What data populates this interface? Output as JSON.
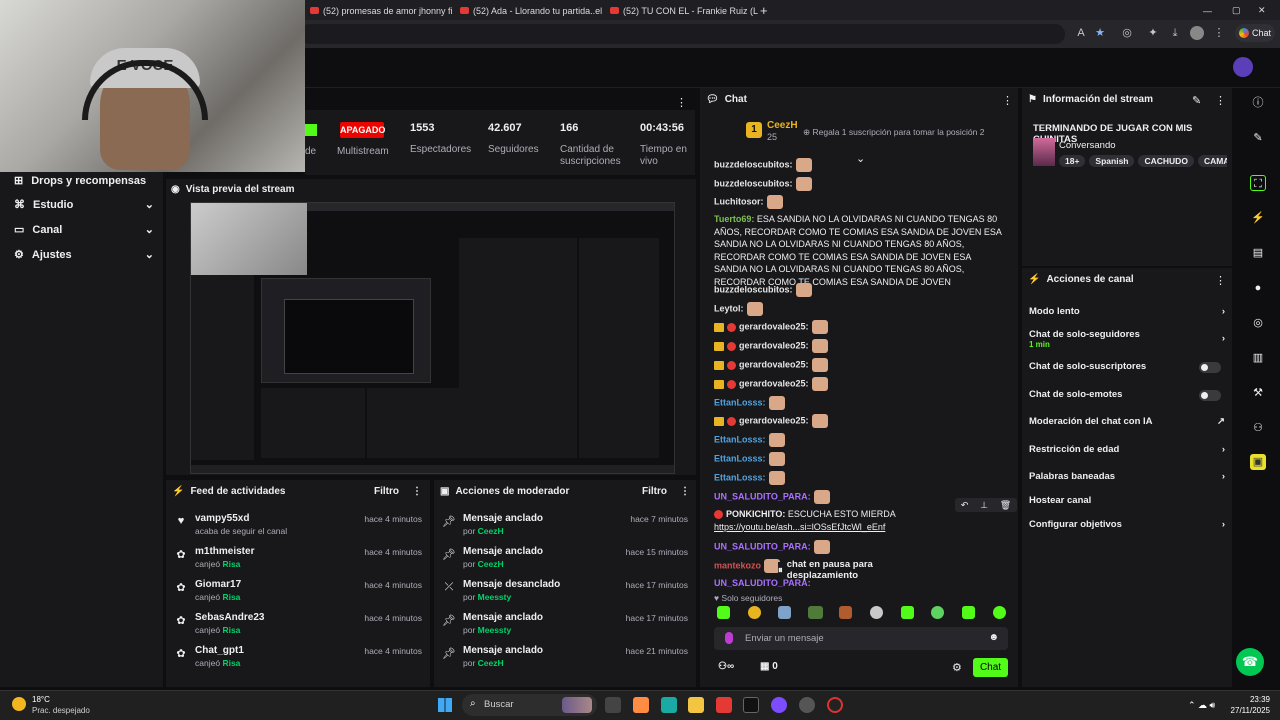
{
  "browser": {
    "tabs": [
      {
        "label": "(52) promesas de amor jhonny fi"
      },
      {
        "label": "(52) Ada - Llorando tu partida..el"
      },
      {
        "label": "(52) TU CON EL - Frankie Ruiz (Le"
      }
    ],
    "chat_button": "Chat"
  },
  "webcam": {
    "cap_text": "E VOCE"
  },
  "nav": {
    "items": [
      {
        "label": "Drops y recompensas"
      },
      {
        "label": "Estudio"
      },
      {
        "label": "Canal"
      },
      {
        "label": "Ajustes"
      }
    ]
  },
  "stats": {
    "status_badge": "APAGADO",
    "status_label": "Multistream",
    "left_partial": "de",
    "items": [
      {
        "value": "1553",
        "label": "Espectadores"
      },
      {
        "value": "42.607",
        "label": "Seguidores"
      },
      {
        "value": "166",
        "label": "Cantidad de suscripciones"
      },
      {
        "value": "00:43:56",
        "label": "Tiempo en vivo"
      }
    ]
  },
  "preview": {
    "title": "Vista previa del stream"
  },
  "feed": {
    "title": "Feed de actividades",
    "filter": "Filtro",
    "rows": [
      {
        "user": "vampy55xd",
        "detail": "acaba de seguir el canal",
        "highlight": "",
        "time": "hace 4 minutos"
      },
      {
        "user": "m1thmeister",
        "detail": "canjeó",
        "highlight": "Risa",
        "time": "hace 4 minutos"
      },
      {
        "user": "Giomar17",
        "detail": "canjeó",
        "highlight": "Risa",
        "time": "hace 4 minutos"
      },
      {
        "user": "SebasAndre23",
        "detail": "canjeó",
        "highlight": "Risa",
        "time": "hace 4 minutos"
      },
      {
        "user": "Chat_gpt1",
        "detail": "canjeó",
        "highlight": "Risa",
        "time": "hace 4 minutos"
      }
    ]
  },
  "mods": {
    "title": "Acciones de moderador",
    "filter": "Filtro",
    "rows": [
      {
        "action": "Mensaje anclado",
        "by": "por",
        "user": "CeezH",
        "time": "hace 7 minutos"
      },
      {
        "action": "Mensaje anclado",
        "by": "por",
        "user": "CeezH",
        "time": "hace 15 minutos"
      },
      {
        "action": "Mensaje desanclado",
        "by": "por",
        "user": "Meessty",
        "time": "hace 17 minutos"
      },
      {
        "action": "Mensaje anclado",
        "by": "por",
        "user": "Meessty",
        "time": "hace 17 minutos"
      },
      {
        "action": "Mensaje anclado",
        "by": "por",
        "user": "CeezH",
        "time": "hace 21 minutos"
      }
    ]
  },
  "chat": {
    "title": "Chat",
    "top_user": "CeezH",
    "top_count": "25",
    "rank": "1",
    "sub_prompt": "Regala 1 suscripción para tomar la posición 2",
    "messages": [
      {
        "user": "buzzdeloscubitos:",
        "color": "#e6e6e6",
        "text": ""
      },
      {
        "user": "buzzdeloscubitos:",
        "color": "#e6e6e6",
        "text": ""
      },
      {
        "user": "Luchitosor:",
        "color": "#e6e6e6",
        "text": ""
      },
      {
        "user": "Tuerto69:",
        "color": "#7ec04f",
        "text": "ESA SANDIA NO LA OLVIDARAS NI CUANDO TENGAS 80 AÑOS, RECORDAR COMO TE COMIAS ESA SANDIA DE JOVEN ESA SANDIA NO LA OLVIDARAS NI CUANDO TENGAS 80 AÑOS, RECORDAR COMO TE COMIAS ESA SANDIA DE JOVEN ESA SANDIA NO LA OLVIDARAS NI CUANDO TENGAS 80 AÑOS, RECORDAR COMO TE COMIAS ESA SANDIA DE JOVEN"
      },
      {
        "user": "buzzdeloscubitos:",
        "color": "#e6e6e6",
        "text": ""
      },
      {
        "user": "Leytol:",
        "color": "#e6e6e6",
        "text": ""
      },
      {
        "user": "gerardovaleo25:",
        "color": "#e6e6e6",
        "text": ""
      },
      {
        "user": "gerardovaleo25:",
        "color": "#e6e6e6",
        "text": ""
      },
      {
        "user": "gerardovaleo25:",
        "color": "#e6e6e6",
        "text": ""
      },
      {
        "user": "gerardovaleo25:",
        "color": "#e6e6e6",
        "text": ""
      },
      {
        "user": "EttanLosss:",
        "color": "#4fa3e0",
        "text": ""
      },
      {
        "user": "gerardovaleo25:",
        "color": "#e6e6e6",
        "text": ""
      },
      {
        "user": "EttanLosss:",
        "color": "#4fa3e0",
        "text": ""
      },
      {
        "user": "EttanLosss:",
        "color": "#4fa3e0",
        "text": ""
      },
      {
        "user": "EttanLosss:",
        "color": "#4fa3e0",
        "text": ""
      },
      {
        "user": "UN_SALUDITO_PARA:",
        "color": "#a970ff",
        "text": ""
      },
      {
        "user": "PONKICHITO:",
        "color": "#e6e6e6",
        "text": "ESCUCHA ESTO MIERDA",
        "link": "https://youtu.be/ash...si=lOSsEfJtcWl_eEnf"
      },
      {
        "user": "UN_SALUDITO_PARA:",
        "color": "#a970ff",
        "text": ""
      },
      {
        "user": "mantekozo",
        "color": "#d15252",
        "text": ""
      },
      {
        "user": "UN_SALUDITO_PARA:",
        "color": "#a970ff",
        "text": ""
      }
    ],
    "paused": "chat en pausa para desplazamiento",
    "mode": "Solo seguidores",
    "input_placeholder": "Enviar un mensaje",
    "points": "0",
    "send": "Chat"
  },
  "info": {
    "title": "Información del stream",
    "stream_title": "TERMINANDO DE JUGAR CON MIS CHINITAS",
    "category": "Conversando",
    "tags": [
      "18+",
      "Spanish",
      "CACHUDO",
      "CAMARON"
    ]
  },
  "acciones": {
    "title": "Acciones de canal",
    "rows": [
      {
        "label": "Modo lento",
        "sub": "",
        "control": "chevron"
      },
      {
        "label": "Chat de solo-seguidores",
        "sub": "1 min",
        "control": "chevron"
      },
      {
        "label": "Chat de solo-suscriptores",
        "sub": "",
        "control": "toggle"
      },
      {
        "label": "Chat de solo-emotes",
        "sub": "",
        "control": "toggle"
      },
      {
        "label": "Moderación del chat con IA",
        "sub": "",
        "control": "external"
      },
      {
        "label": "Restricción de edad",
        "sub": "",
        "control": "chevron"
      },
      {
        "label": "Palabras baneadas",
        "sub": "",
        "control": "chevron"
      },
      {
        "label": "Hostear canal",
        "sub": "",
        "control": "none"
      },
      {
        "label": "Configurar objetivos",
        "sub": "",
        "control": "chevron"
      }
    ]
  },
  "taskbar": {
    "weather_temp": "18°C",
    "weather_desc": "Prac. despejado",
    "search": "Buscar",
    "time": "23:39",
    "date": "27/11/2025"
  },
  "colors": {
    "accent_green": "#53fc18",
    "bg": "#0e0e10",
    "panel": "#18181b",
    "red": "#eb0400"
  }
}
